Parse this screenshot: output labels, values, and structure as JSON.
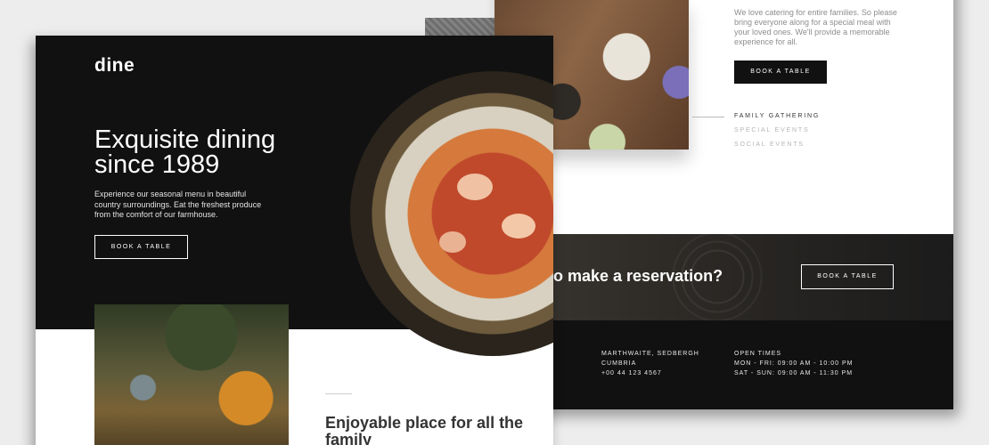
{
  "back": {
    "intro_text": "We love catering for entire families. So please bring everyone along for a special meal with your loved ones. We'll provide a memorable experience for all.",
    "book_label": "BOOK A TABLE",
    "tabs": [
      {
        "label": "FAMILY GATHERING",
        "active": true
      },
      {
        "label": "SPECIAL EVENTS",
        "active": false
      },
      {
        "label": "SOCIAL EVENTS",
        "active": false
      }
    ],
    "reservation_title": "o make a reservation?",
    "reservation_button": "BOOK A TABLE",
    "footer": {
      "address_line1": "MARTHWAITE, SEDBERGH",
      "address_line2": "CUMBRIA",
      "phone": "+00 44 123 4567",
      "hours_title": "OPEN TIMES",
      "hours_weekday": "MON - FRI: 09:00 AM - 10:00 PM",
      "hours_weekend": "SAT - SUN: 09:00 AM - 11:30 PM"
    }
  },
  "front": {
    "logo": "dine",
    "hero_title": "Exquisite dining since 1989",
    "hero_text": "Experience our seasonal menu in beautiful country surroundings. Eat the freshest produce from the comfort of our farmhouse.",
    "hero_button": "BOOK A TABLE",
    "section_title": "Enjoyable place for all the family"
  },
  "colors": {
    "background": "#ededed",
    "dark": "#111111",
    "white": "#ffffff"
  }
}
